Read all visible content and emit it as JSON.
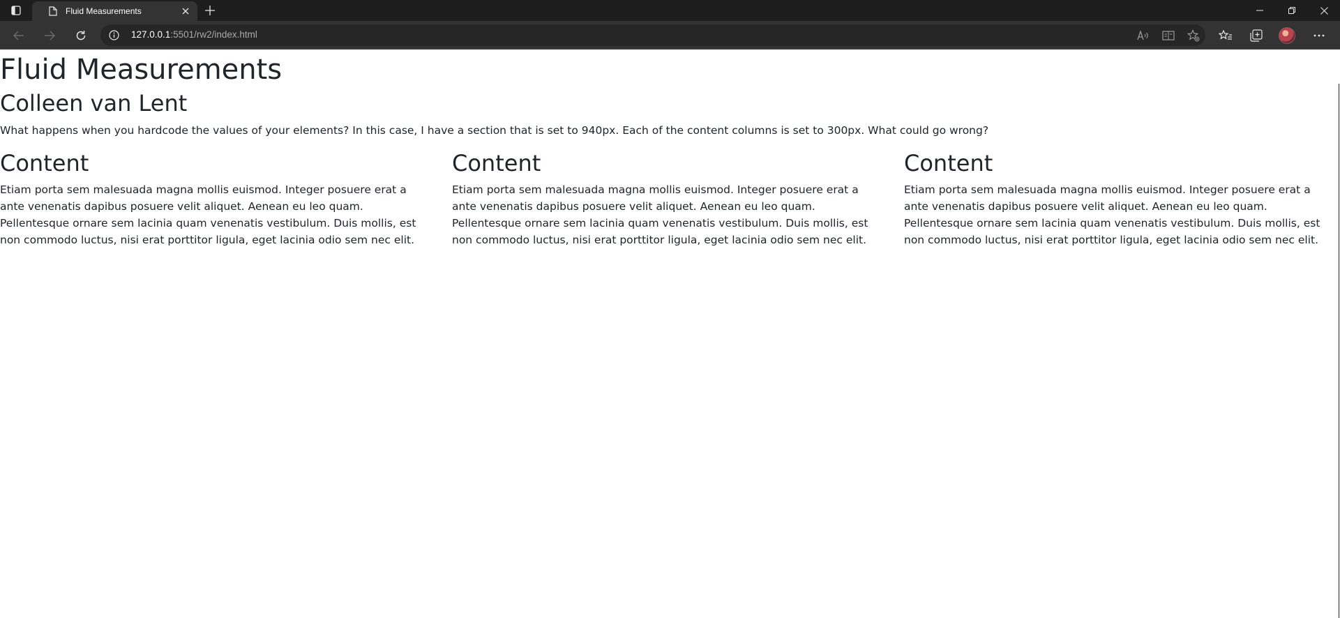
{
  "browser": {
    "tab_title": "Fluid Measurements",
    "url_host": "127.0.0.1",
    "url_path": ":5501/rw2/index.html"
  },
  "page": {
    "title": "Fluid Measurements",
    "author": "Colleen van Lent",
    "intro": "What happens when you hardcode the values of your elements? In this case, I have a section that is set to 940px. Each of the content columns is set to 300px. What could go wrong?",
    "columns": [
      {
        "heading": "Content",
        "body": "Etiam porta sem malesuada magna mollis euismod. Integer posuere erat a ante venenatis dapibus posuere velit aliquet. Aenean eu leo quam. Pellentesque ornare sem lacinia quam venenatis vestibulum. Duis mollis, est non commodo luctus, nisi erat porttitor ligula, eget lacinia odio sem nec elit."
      },
      {
        "heading": "Content",
        "body": "Etiam porta sem malesuada magna mollis euismod. Integer posuere erat a ante venenatis dapibus posuere velit aliquet. Aenean eu leo quam. Pellentesque ornare sem lacinia quam venenatis vestibulum. Duis mollis, est non commodo luctus, nisi erat porttitor ligula, eget lacinia odio sem nec elit."
      },
      {
        "heading": "Content",
        "body": "Etiam porta sem malesuada magna mollis euismod. Integer posuere erat a ante venenatis dapibus posuere velit aliquet. Aenean eu leo quam. Pellentesque ornare sem lacinia quam venenatis vestibulum. Duis mollis, est non commodo luctus, nisi erat porttitor ligula, eget lacinia odio sem nec elit."
      }
    ]
  },
  "icons": {
    "tab_actions": "tab-actions-icon",
    "tab_page": "page-icon",
    "tab_close": "close-icon",
    "new_tab": "plus-icon",
    "minimize": "minimize-icon",
    "restore": "restore-icon",
    "close_window": "close-icon",
    "back": "back-arrow-icon",
    "forward": "forward-arrow-icon",
    "refresh": "refresh-icon",
    "site_info": "info-icon",
    "read_aloud": "read-aloud-icon",
    "immersive_reader": "immersive-reader-icon",
    "add_favorite": "star-add-icon",
    "favorites": "favorites-icon",
    "collections": "collections-icon",
    "profile": "avatar",
    "more": "more-icon"
  },
  "colors": {
    "tabbar_bg": "#1d1d1d",
    "toolbar_bg": "#333333",
    "address_bg": "#262626",
    "page_text": "#212529",
    "page_bg": "#ffffff"
  }
}
